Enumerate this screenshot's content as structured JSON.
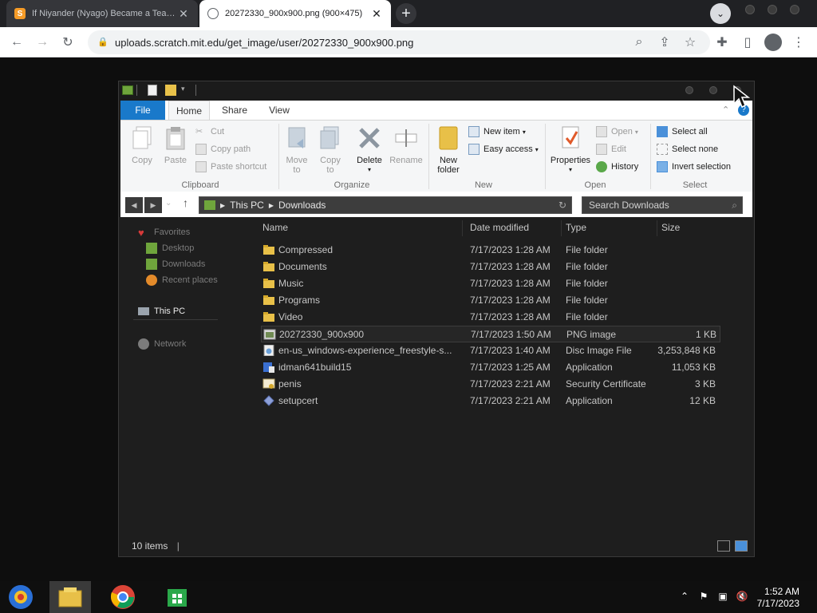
{
  "browser": {
    "tabs": [
      {
        "title": "If Niyander (Nyago) Became a Teacher",
        "favicon": "S",
        "active": false
      },
      {
        "title": "20272330_900x900.png (900×475)",
        "active": true
      }
    ],
    "url": "uploads.scratch.mit.edu/get_image/user/20272330_900x900.png"
  },
  "explorer": {
    "ribbon_tabs": [
      "File",
      "Home",
      "Share",
      "View"
    ],
    "clipboard": {
      "copy": "Copy",
      "paste": "Paste",
      "cut": "Cut",
      "copy_path": "Copy path",
      "paste_shortcut": "Paste shortcut",
      "group": "Clipboard"
    },
    "organize": {
      "move_to_1": "Move",
      "move_to_2": "to",
      "copy_to_1": "Copy",
      "copy_to_2": "to",
      "delete": "Delete",
      "rename": "Rename",
      "group": "Organize"
    },
    "new": {
      "new_folder_1": "New",
      "new_folder_2": "folder",
      "new_item": "New item",
      "easy_access": "Easy access",
      "group": "New"
    },
    "open": {
      "properties": "Properties",
      "open": "Open",
      "edit": "Edit",
      "history": "History",
      "group": "Open"
    },
    "select": {
      "select_all": "Select all",
      "select_none": "Select none",
      "invert": "Invert selection",
      "group": "Select"
    },
    "breadcrumb": [
      "This PC",
      "Downloads"
    ],
    "search_placeholder": "Search Downloads",
    "nav": {
      "favorites": "Favorites",
      "desktop": "Desktop",
      "downloads": "Downloads",
      "recent": "Recent places",
      "this_pc": "This PC",
      "network": "Network"
    },
    "columns": {
      "name": "Name",
      "date": "Date modified",
      "type": "Type",
      "size": "Size"
    },
    "files": [
      {
        "name": "Compressed",
        "date": "7/17/2023 1:28 AM",
        "type": "File folder",
        "size": "",
        "icon": "folder-icon"
      },
      {
        "name": "Documents",
        "date": "7/17/2023 1:28 AM",
        "type": "File folder",
        "size": "",
        "icon": "folder-icon"
      },
      {
        "name": "Music",
        "date": "7/17/2023 1:28 AM",
        "type": "File folder",
        "size": "",
        "icon": "folder-icon"
      },
      {
        "name": "Programs",
        "date": "7/17/2023 1:28 AM",
        "type": "File folder",
        "size": "",
        "icon": "folder-icon"
      },
      {
        "name": "Video",
        "date": "7/17/2023 1:28 AM",
        "type": "File folder",
        "size": "",
        "icon": "folder-icon"
      },
      {
        "name": "20272330_900x900",
        "date": "7/17/2023 1:50 AM",
        "type": "PNG image",
        "size": "1 KB",
        "icon": "image-file-icon"
      },
      {
        "name": "en-us_windows-experience_freestyle-s...",
        "date": "7/17/2023 1:40 AM",
        "type": "Disc Image File",
        "size": "3,253,848 KB",
        "icon": "disc-image-icon"
      },
      {
        "name": "idman641build15",
        "date": "7/17/2023 1:25 AM",
        "type": "Application",
        "size": "11,053 KB",
        "icon": "installer-icon"
      },
      {
        "name": "penis",
        "date": "7/17/2023 2:21 AM",
        "type": "Security Certificate",
        "size": "3 KB",
        "icon": "certificate-icon"
      },
      {
        "name": "setupcert",
        "date": "7/17/2023 2:21 AM",
        "type": "Application",
        "size": "12 KB",
        "icon": "application-icon"
      }
    ],
    "status": "10 items"
  },
  "taskbar": {
    "time": "1:52 AM",
    "date": "7/17/2023"
  }
}
